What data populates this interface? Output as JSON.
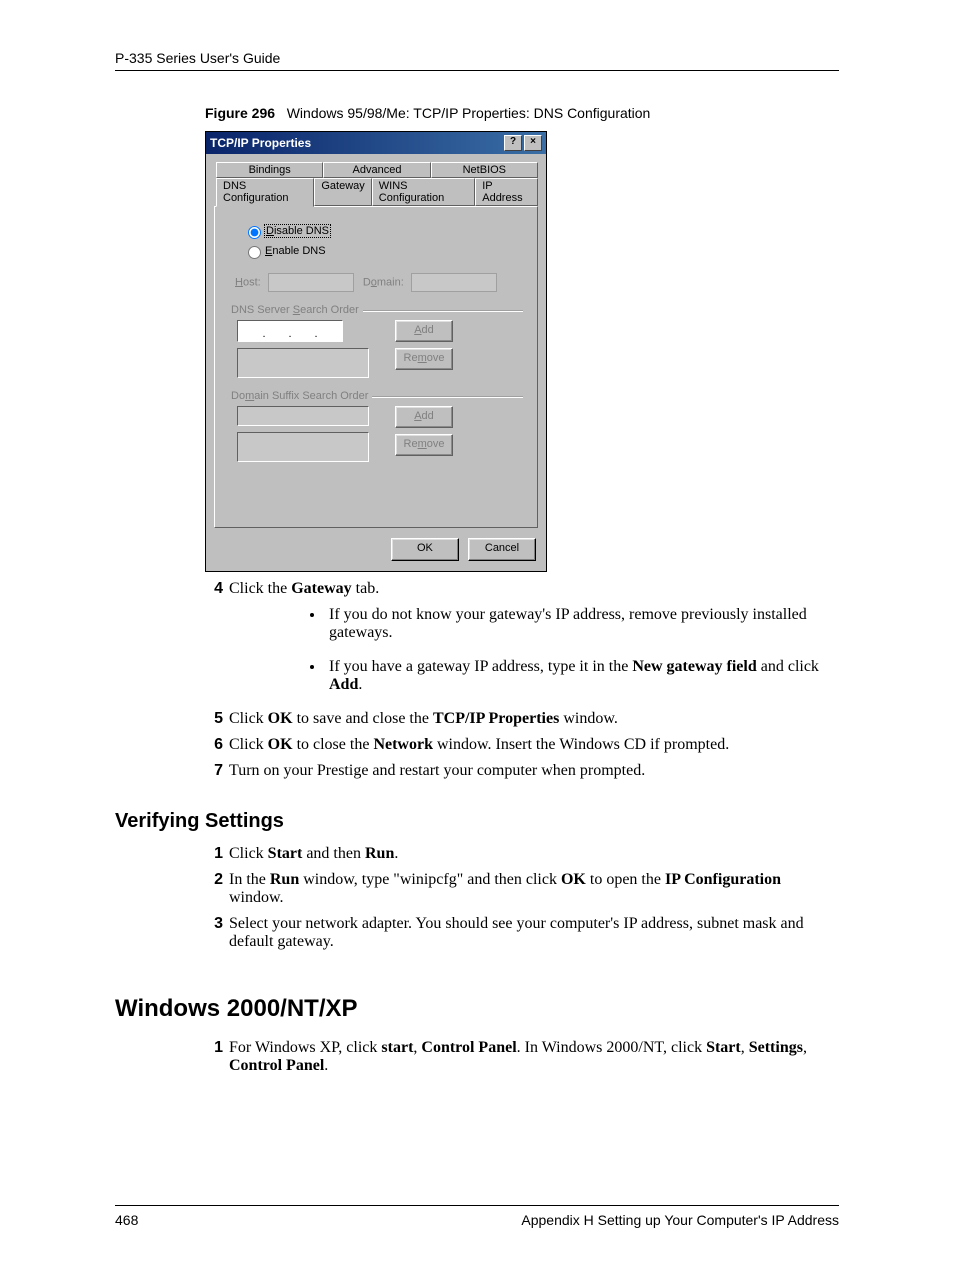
{
  "header": {
    "guide_title": "P-335 Series User's Guide"
  },
  "figure": {
    "label": "Figure 296",
    "caption": "Windows 95/98/Me: TCP/IP Properties: DNS Configuration"
  },
  "dialog": {
    "title": "TCP/IP Properties",
    "help_btn": "?",
    "close_btn": "×",
    "tabs_top": [
      "Bindings",
      "Advanced",
      "NetBIOS"
    ],
    "tabs_bottom": [
      "DNS Configuration",
      "Gateway",
      "WINS Configuration",
      "IP Address"
    ],
    "radios": {
      "disable_prefix": "D",
      "disable_rest": "isable DNS",
      "enable_prefix": "E",
      "enable_rest": "nable DNS"
    },
    "host_label_prefix": "H",
    "host_label_rest": "ost:",
    "domain_label_prefix": "D",
    "domain_label_rest": "o",
    "domain_label_rest2": "main:",
    "dns_order_prefix": "DNS Server ",
    "dns_order_u": "S",
    "dns_order_rest": "earch Order",
    "domain_suffix_prefix": "Do",
    "domain_suffix_u": "m",
    "domain_suffix_rest": "ain Suffix Search Order",
    "add_btn_prefix": "A",
    "add_btn_rest": "dd",
    "remove_btn_prefix": "Re",
    "remove_btn_u": "m",
    "remove_btn_rest": "ove",
    "ok": "OK",
    "cancel": "Cancel",
    "dot": "."
  },
  "steps_a": {
    "n4": "4",
    "s4_pre": "Click the ",
    "s4_b": "Gateway",
    "s4_post": " tab.",
    "b1_pre": "If you do not know your gateway's IP address, remove previously installed gateways.",
    "b2_pre": "If you have a gateway IP address, type it in the ",
    "b2_b": "New gateway field",
    "b2_mid": " and click ",
    "b2_b2": "Add",
    "b2_post": ".",
    "n5": "5",
    "s5_pre": "Click ",
    "s5_b1": "OK",
    "s5_mid": " to save and close the ",
    "s5_b2": "TCP/IP Properties",
    "s5_post": " window.",
    "n6": "6",
    "s6_pre": "Click ",
    "s6_b1": "OK",
    "s6_mid": " to close the ",
    "s6_b2": "Network",
    "s6_post": " window. Insert the Windows CD if prompted.",
    "n7": "7",
    "s7": "Turn on your Prestige and restart your computer when prompted."
  },
  "section_verify": {
    "heading": "Verifying Settings",
    "n1": "1",
    "s1_pre": "Click ",
    "s1_b1": "Start",
    "s1_mid": " and then ",
    "s1_b2": "Run",
    "s1_post": ".",
    "n2": "2",
    "s2_pre": "In the ",
    "s2_b1": "Run",
    "s2_mid": " window, type \"winipcfg\" and then click ",
    "s2_b2": "OK",
    "s2_mid2": " to open the ",
    "s2_b3": "IP Configuration",
    "s2_post": " window.",
    "n3": "3",
    "s3": "Select your network adapter. You should see your computer's IP address, subnet mask and default gateway."
  },
  "section_win2k": {
    "heading": "Windows 2000/NT/XP",
    "n1": "1",
    "s1_pre": "For Windows XP, click ",
    "s1_b1": "start",
    "s1_mid1": ", ",
    "s1_b2": "Control Panel",
    "s1_mid2": ". In Windows 2000/NT, click ",
    "s1_b3": "Start",
    "s1_mid3": ", ",
    "s1_b4": "Settings",
    "s1_mid4": ", ",
    "s1_b5": "Control Panel",
    "s1_post": "."
  },
  "footer": {
    "page": "468",
    "appendix": "Appendix H Setting up Your Computer's IP Address"
  }
}
